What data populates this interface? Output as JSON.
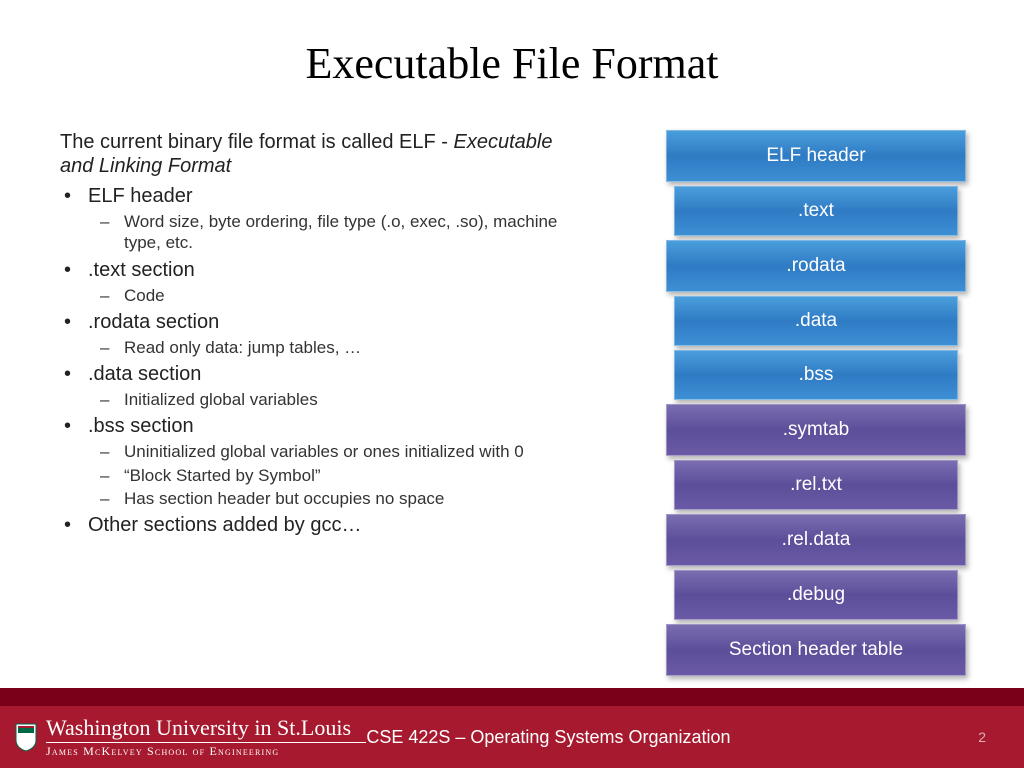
{
  "title": "Executable File Format",
  "intro_prefix": "The current binary file format is called ELF - ",
  "intro_italic": "Executable and Linking Format",
  "bullets": {
    "b1": "ELF header",
    "b1s1": "Word size, byte ordering, file type (.o, exec, .so), machine type, etc.",
    "b2": ".text section",
    "b2s1": "Code",
    "b3": ".rodata section",
    "b3s1": "Read only data: jump tables, …",
    "b4": ".data section",
    "b4s1": "Initialized global variables",
    "b5": ".bss section",
    "b5s1": "Uninitialized global variables or ones initialized with 0",
    "b5s2": "“Block Started by Symbol”",
    "b5s3": "Has section header but occupies no space",
    "b6": "Other sections added by gcc…"
  },
  "diagram": {
    "r0": "ELF header",
    "r1": ".text",
    "r2": ".rodata",
    "r3": ".data",
    "r4": ".bss",
    "r5": ".symtab",
    "r6": ".rel.txt",
    "r7": ".rel.data",
    "r8": ".debug",
    "r9": "Section header table"
  },
  "footer": {
    "university": "Washington University in St.Louis",
    "school": "James McKelvey School of Engineering",
    "course": "CSE 422S – Operating Systems Organization",
    "page": "2"
  }
}
